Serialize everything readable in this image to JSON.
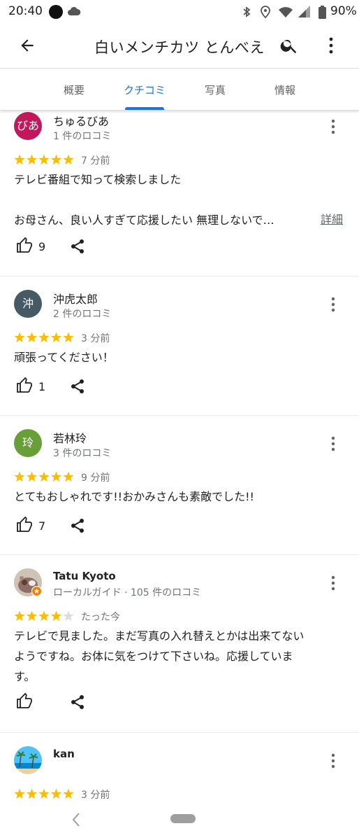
{
  "status_bar": {
    "time": "20:40",
    "battery": "90%"
  },
  "app_bar": {
    "title": "白いメンチカツ とんべえ"
  },
  "tabs": [
    {
      "label": "概要",
      "active": false
    },
    {
      "label": "クチコミ",
      "active": true
    },
    {
      "label": "写真",
      "active": false
    },
    {
      "label": "情報",
      "active": false
    }
  ],
  "reviews": [
    {
      "avatar_text": "びあ",
      "avatar_color": "#c2185b",
      "name": "ちゅるびあ",
      "meta": "1 件のロコミ",
      "rating": 5,
      "time": "7 分前",
      "text_lines": [
        "テレビ番組で知って検索しました",
        "",
        "お母さん、良い人すぎて応援したい 無理しないで…"
      ],
      "more_label": "詳細",
      "likes": "9"
    },
    {
      "avatar_text": "沖",
      "avatar_color": "#455a64",
      "name": "沖虎太郎",
      "meta": "2 件のロコミ",
      "rating": 5,
      "time": "3 分前",
      "text_lines": [
        "頑張ってください！"
      ],
      "likes": "1"
    },
    {
      "avatar_text": "玲",
      "avatar_color": "#689f38",
      "name": "若林玲",
      "meta": "3 件のロコミ",
      "rating": 5,
      "time": "9 分前",
      "text_lines": [
        "とてもおしゃれです!!おかみさんも素敵でした!!"
      ],
      "likes": "7"
    },
    {
      "avatar_text": "",
      "avatar_color": "#a1887f",
      "name": "Tatu Kyoto",
      "meta": "ローカルガイド · 105 件のロコミ",
      "rating": 4,
      "time": "たった今",
      "text_lines": [
        "テレビで見ました。まだ写真の入れ替えとかは出来てない",
        "ようですね。お体に気をつけて下さいね。応援していま",
        "す。"
      ],
      "likes": ""
    },
    {
      "avatar_text": "",
      "avatar_color": "#4fc3f7",
      "name": "kan",
      "meta": "",
      "rating": 5,
      "time": "3 分前",
      "text_lines": [],
      "likes": ""
    }
  ],
  "colors": {
    "accent": "#1a73e8",
    "star": "#fbbc04",
    "star_empty": "#dadce0"
  },
  "icons": [
    "back-arrow-icon",
    "search-icon",
    "more-vert-icon",
    "thumb-up-icon",
    "share-icon",
    "star-icon",
    "local-guide-badge-icon"
  ]
}
